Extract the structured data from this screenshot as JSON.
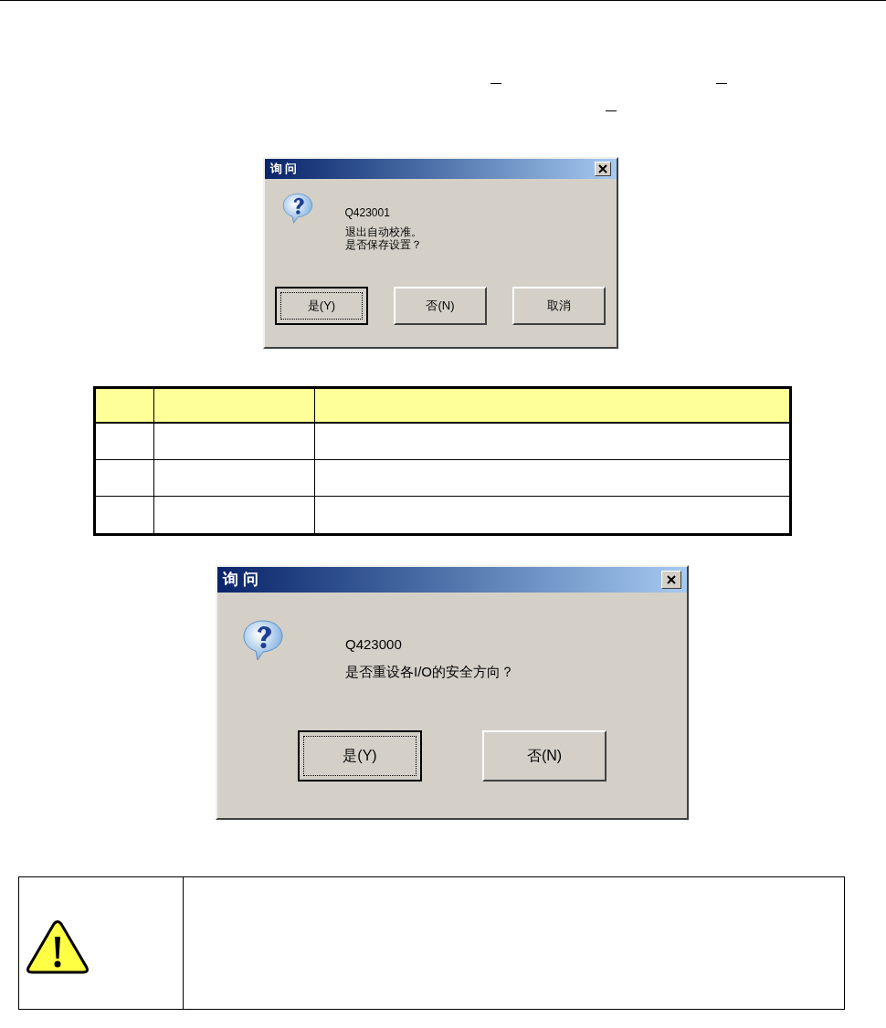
{
  "dialogs": [
    {
      "title": "询 问",
      "code": "Q423001",
      "message": [
        "退出自动校准。",
        "是否保存设置？"
      ],
      "kind": "compact",
      "buttons": [
        {
          "label": "是(Y)",
          "selected": true
        },
        {
          "label": "否(N)",
          "selected": false
        },
        {
          "label": "取消",
          "selected": false
        }
      ]
    },
    {
      "title": "询 问",
      "code": "Q423000",
      "message": [
        "是否重设各I/O的安全方向？"
      ],
      "kind": "wide",
      "buttons": [
        {
          "label": "是(Y)",
          "selected": true
        },
        {
          "label": "否(N)",
          "selected": false
        }
      ]
    }
  ]
}
